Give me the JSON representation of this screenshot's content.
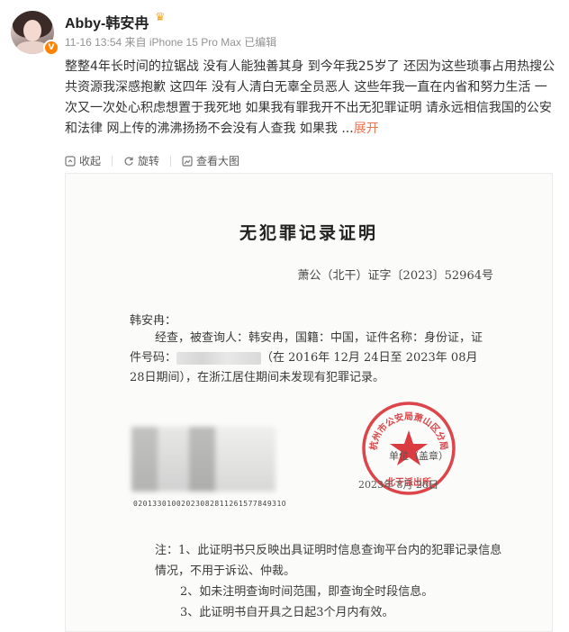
{
  "post": {
    "username": "Abby-韩安冉",
    "timestamp": "11-16 13:54",
    "source": "来自 iPhone 15 Pro Max",
    "edited": "已编辑",
    "text": "整整4年长时间的拉锯战 没有人能独善其身 到今年我25岁了 还因为这些琐事占用热搜公共资源我深感抱歉 这四年 没有人清白无辜全员恶人 这些年我一直在内省和努力生活 一次又一次处心积虑想置于我死地 如果我有罪我开不出无犯罪证明 请永远相信我国的公安和法律 网上传的沸沸扬扬不会没有人查我 如果我 ...",
    "expand_label": "展开"
  },
  "actions": {
    "collect": "收起",
    "rotate": "旋转",
    "view_large": "查看大图"
  },
  "document": {
    "title": "无犯罪记录证明",
    "number": "萧公（北干）证字〔2023〕52964号",
    "addressee": "韩安冉：",
    "body_1": "经查，被查询人：韩安冉，国籍：中国，证件名称：身份证，证件号码：",
    "body_2": "（在 2016年 12月 24日至 2023年 08月 28日期间），在浙江居住期间未发现有犯罪记录。",
    "barcode_number": "0201330100202308281126157784931O",
    "seal_text": "杭州市公安局萧山区分局",
    "seal_bottom": "北干派出所",
    "sign_unit": "单位（盖章）",
    "sign_date": "2023年 8月 28日",
    "note_1": "注：1、此证明书只反映出具证明时信息查询平台内的犯罪记录信息情况，不用于诉讼、仲裁。",
    "note_2": "2、如未注明查询时间范围，即查询全时段信息。",
    "note_3": "3、此证明书自开具之日起3个月内有效。"
  },
  "colors": {
    "accent": "#eb7350",
    "seal_red": "#d6262b",
    "verified": "#ff8200",
    "meta_gray": "#939393"
  }
}
